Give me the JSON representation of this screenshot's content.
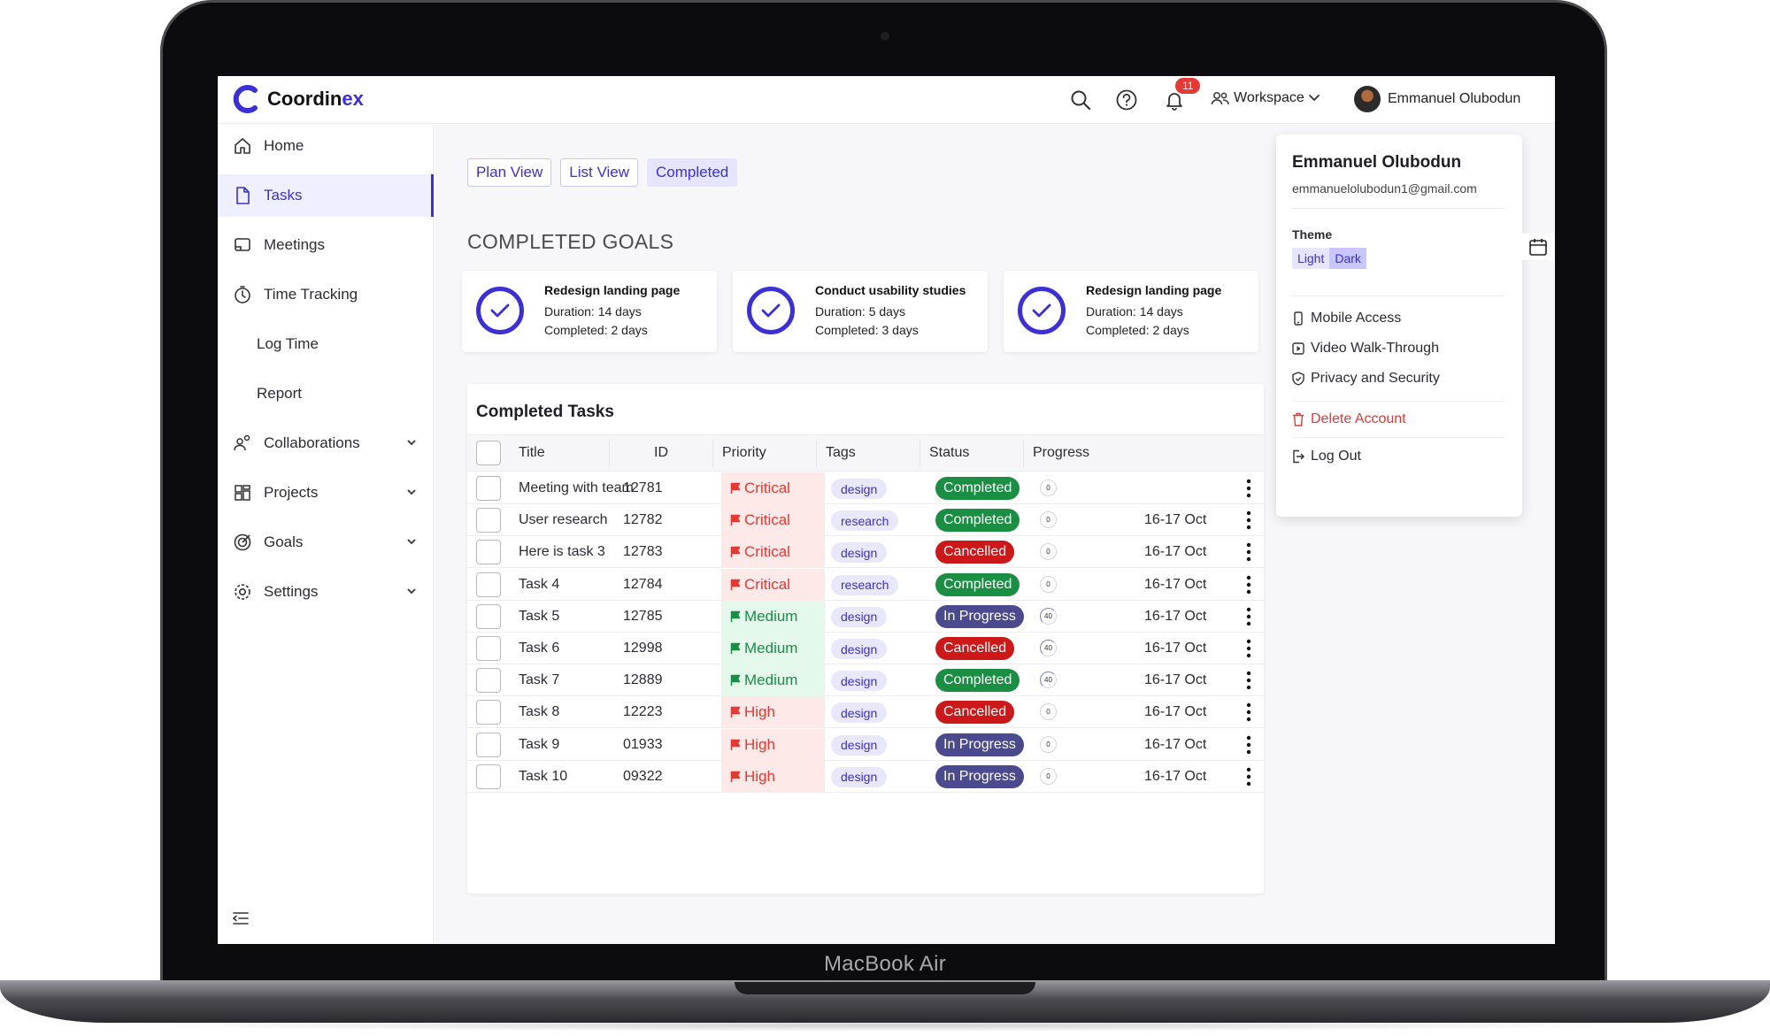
{
  "device": {
    "label": "MacBook Air"
  },
  "app": {
    "name_main": "Coordin",
    "name_accent": "ex"
  },
  "topbar": {
    "notifications_count": "11",
    "workspace_label": "Workspace",
    "user_name": "Emmanuel Olubodun"
  },
  "sidebar": {
    "items": [
      {
        "label": "Home"
      },
      {
        "label": "Tasks"
      },
      {
        "label": "Meetings"
      },
      {
        "label": "Time Tracking"
      },
      {
        "label": "Log Time"
      },
      {
        "label": "Report"
      },
      {
        "label": "Collaborations"
      },
      {
        "label": "Projects"
      },
      {
        "label": "Goals"
      },
      {
        "label": "Settings"
      }
    ]
  },
  "views": {
    "tabs": [
      "Plan View",
      "List View",
      "Completed"
    ],
    "selected": "Completed"
  },
  "goals": {
    "title": "COMPLETED GOALS",
    "cards": [
      {
        "title": "Redesign landing page",
        "duration": "Duration: 14 days",
        "completed": "Completed: 2 days"
      },
      {
        "title": "Conduct usability studies",
        "duration": "Duration: 5 days",
        "completed": "Completed: 3 days"
      },
      {
        "title": "Redesign landing page",
        "duration": "Duration: 14 days",
        "completed": "Completed: 2 days"
      }
    ]
  },
  "tasks_table": {
    "title": "Completed Tasks",
    "columns": [
      "Title",
      "ID",
      "Priority",
      "Tags",
      "Status",
      "Progress"
    ],
    "rows": [
      {
        "title": "Meeting with team",
        "id": "12781",
        "priority": "Critical",
        "tag": "design",
        "status": "Completed",
        "progress": "0",
        "date": ""
      },
      {
        "title": "User research",
        "id": "12782",
        "priority": "Critical",
        "tag": "research",
        "status": "Completed",
        "progress": "0",
        "date": "16-17 Oct"
      },
      {
        "title": "Here is task 3",
        "id": "12783",
        "priority": "Critical",
        "tag": "design",
        "status": "Cancelled",
        "progress": "0",
        "date": "16-17 Oct"
      },
      {
        "title": "Task 4",
        "id": "12784",
        "priority": "Critical",
        "tag": "research",
        "status": "Completed",
        "progress": "0",
        "date": "16-17 Oct"
      },
      {
        "title": "Task 5",
        "id": "12785",
        "priority": "Medium",
        "tag": "design",
        "status": "In Progress",
        "progress": "40",
        "date": "16-17 Oct"
      },
      {
        "title": "Task 6",
        "id": "12998",
        "priority": "Medium",
        "tag": "design",
        "status": "Cancelled",
        "progress": "40",
        "date": "16-17 Oct"
      },
      {
        "title": "Task 7",
        "id": "12889",
        "priority": "Medium",
        "tag": "design",
        "status": "Completed",
        "progress": "40",
        "date": "16-17 Oct"
      },
      {
        "title": "Task 8",
        "id": "12223",
        "priority": "High",
        "tag": "design",
        "status": "Cancelled",
        "progress": "0",
        "date": "16-17 Oct"
      },
      {
        "title": "Task 9",
        "id": "01933",
        "priority": "High",
        "tag": "design",
        "status": "In Progress",
        "progress": "0",
        "date": "16-17 Oct"
      },
      {
        "title": "Task 10",
        "id": "09322",
        "priority": "High",
        "tag": "design",
        "status": "In Progress",
        "progress": "0",
        "date": "16-17 Oct"
      }
    ]
  },
  "user_menu": {
    "name": "Emmanuel Olubodun",
    "email": "emmanuelolubodun1@gmail.com",
    "theme_label": "Theme",
    "theme_options": [
      "Light",
      "Dark"
    ],
    "theme_selected": "Dark",
    "items": [
      "Mobile Access",
      "Video Walk-Through",
      "Privacy and Security"
    ],
    "delete_label": "Delete Account",
    "logout_label": "Log Out"
  },
  "colors": {
    "accent": "#3b2fd8",
    "status_completed": "#1a8f44",
    "status_cancelled": "#cc1818",
    "status_in_progress": "#4b4a8f",
    "priority_critical_high": "#e53935",
    "priority_medium": "#178f44"
  },
  "icons": [
    "search-icon",
    "help-icon",
    "bell-icon",
    "users-icon",
    "chevron-down-icon",
    "home-icon",
    "file-icon",
    "meetings-icon",
    "timer-icon",
    "collaborations-icon",
    "projects-icon",
    "goals-icon",
    "gear-icon",
    "check-circle-icon",
    "flag-icon",
    "kebab-icon",
    "phone-icon",
    "video-icon",
    "shield-icon",
    "trash-icon",
    "logout-icon",
    "calendar-icon",
    "collapse-menu-icon"
  ]
}
